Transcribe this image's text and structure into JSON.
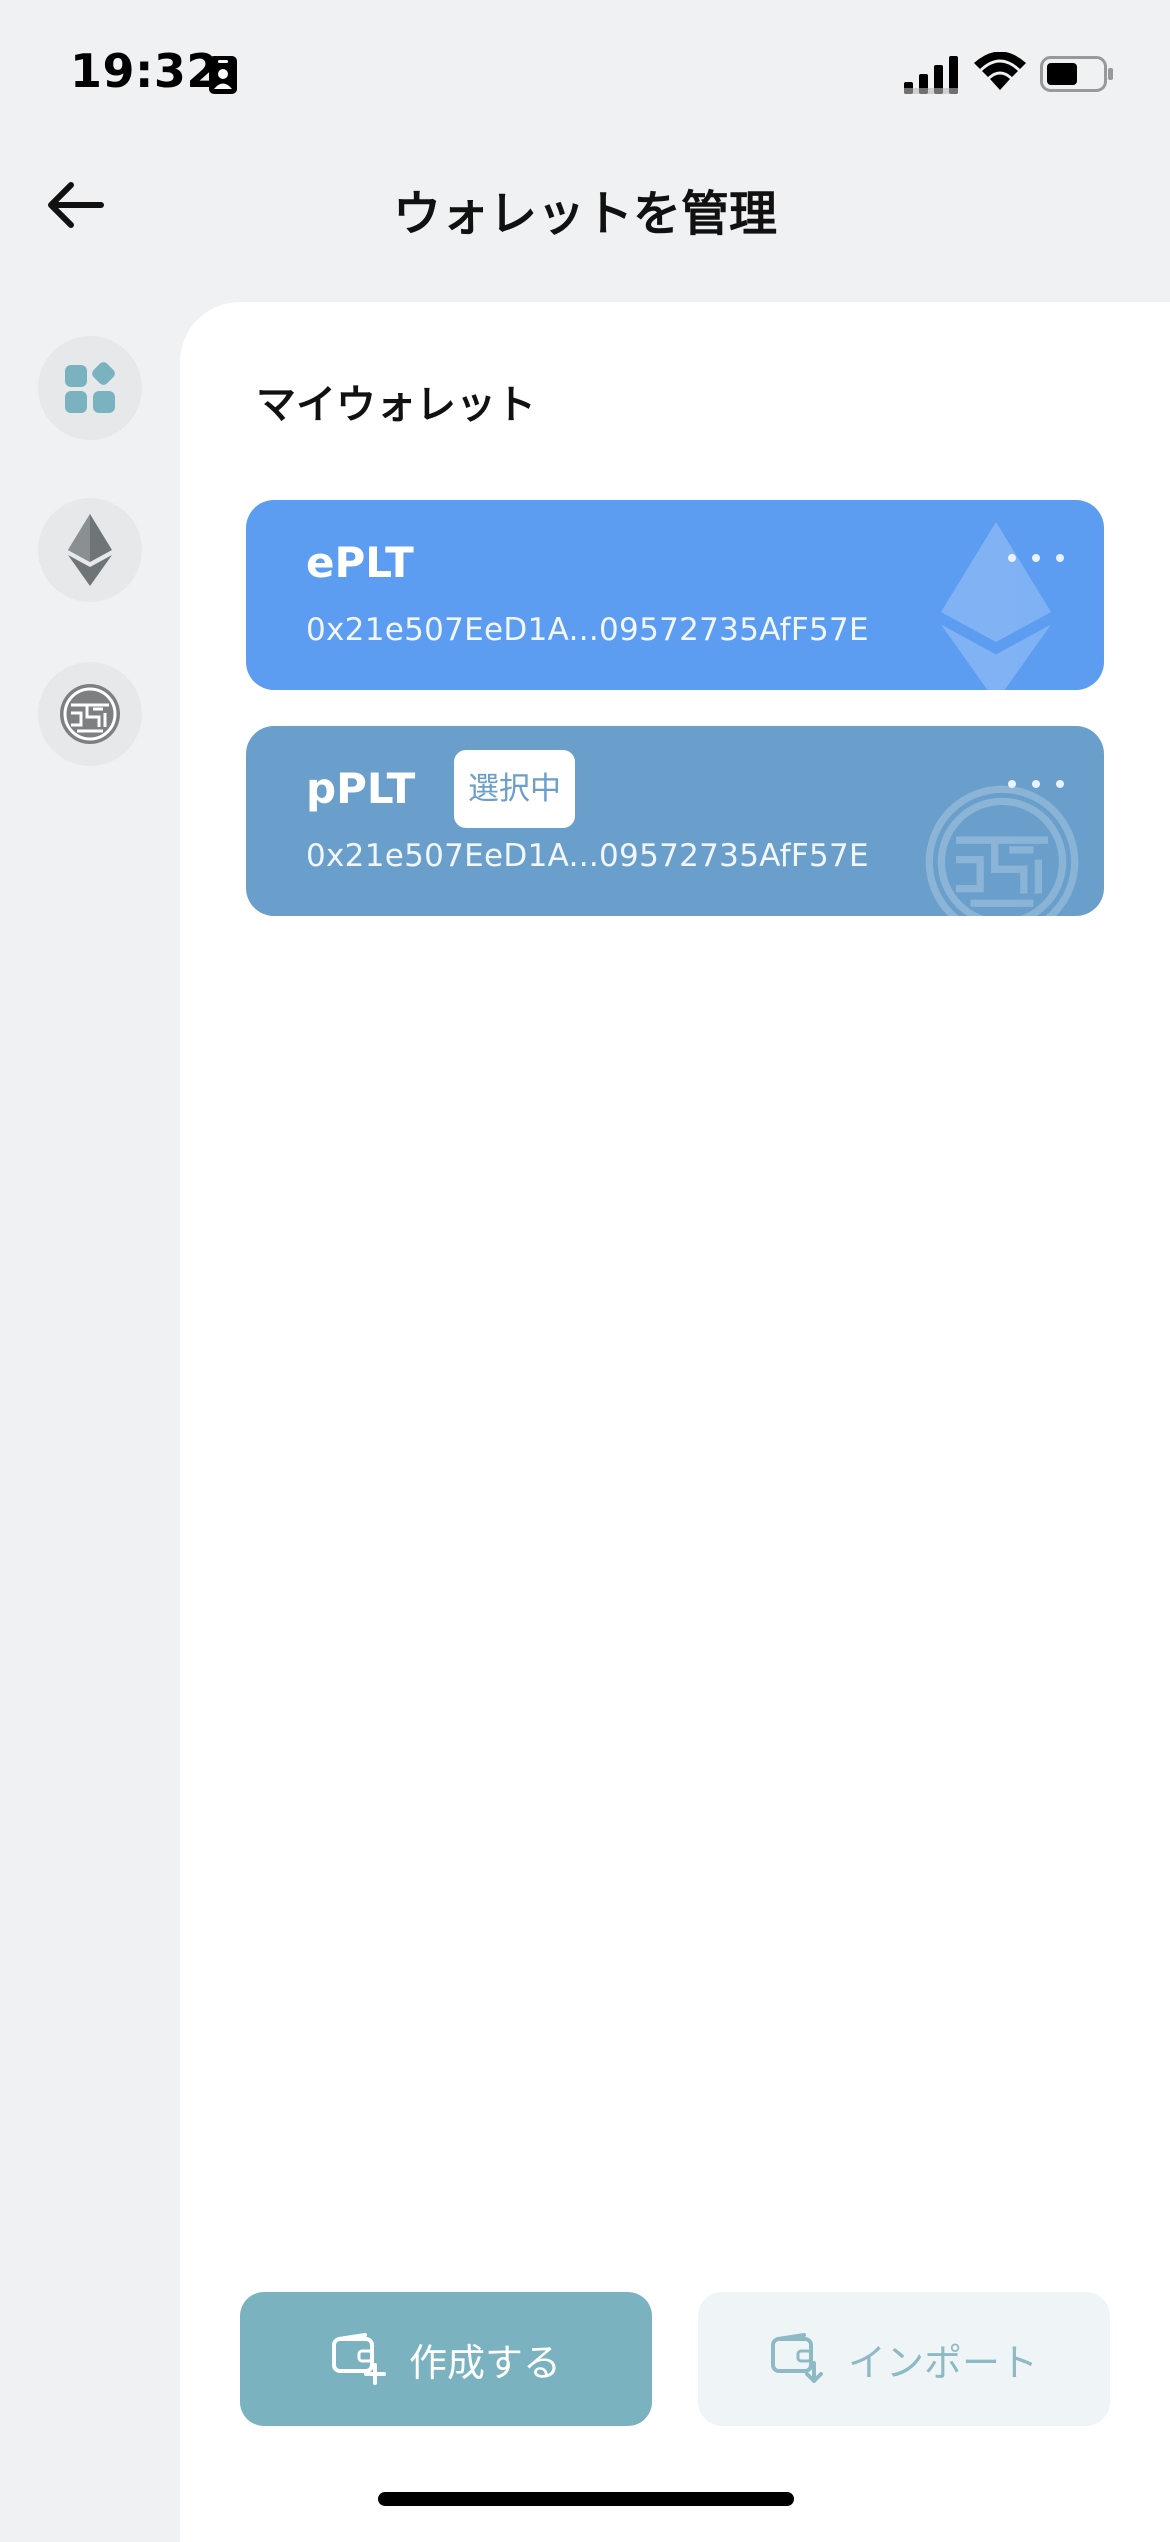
{
  "status_bar": {
    "time": "19:32"
  },
  "header": {
    "title": "ウォレットを管理"
  },
  "rail": {
    "items": [
      {
        "icon": "apps-grid-icon"
      },
      {
        "icon": "ethereum-icon"
      },
      {
        "icon": "plt-logo-icon"
      }
    ]
  },
  "section": {
    "title": "マイウォレット"
  },
  "wallets": [
    {
      "name": "ePLT",
      "address": "0x21e507EeD1A...09572735AfF57E",
      "selected": false,
      "color": "#5C9DF2"
    },
    {
      "name": "pPLT",
      "address": "0x21e507EeD1A...09572735AfF57E",
      "selected": true,
      "badge": "選択中",
      "color": "#6A9FCB"
    }
  ],
  "actions": {
    "create_label": "作成する",
    "import_label": "インポート"
  },
  "colors": {
    "accent": "#7AB3BF",
    "background": "#F0F1F3"
  }
}
